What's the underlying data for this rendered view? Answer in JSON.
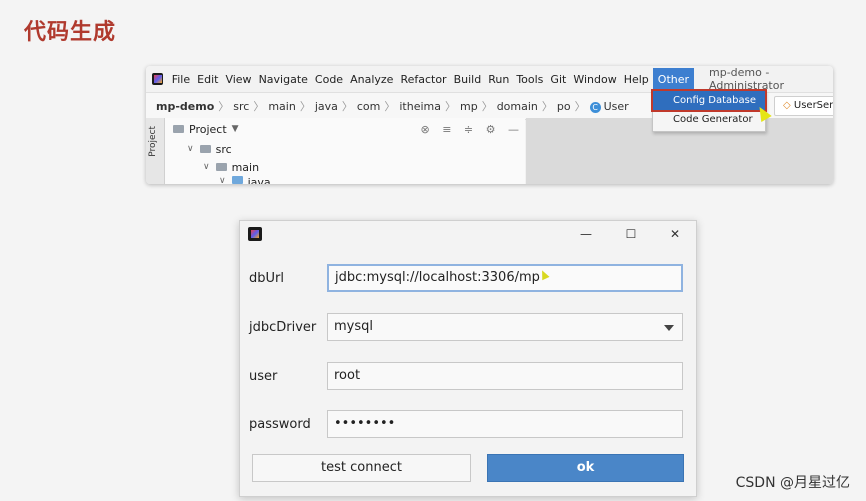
{
  "slide": {
    "title": "代码生成"
  },
  "ide": {
    "menu": [
      "File",
      "Edit",
      "View",
      "Navigate",
      "Code",
      "Analyze",
      "Refactor",
      "Build",
      "Run",
      "Tools",
      "Git",
      "Window",
      "Help",
      "Other"
    ],
    "window_title": "mp-demo - Administrator",
    "breadcrumb": [
      "mp-demo",
      "src",
      "main",
      "java",
      "com",
      "itheima",
      "mp",
      "domain",
      "po",
      "User"
    ],
    "file_tab": "UserSer",
    "side_tab": "Project",
    "project_panel": {
      "title": "Project",
      "tree": [
        "src",
        "main",
        "java"
      ]
    },
    "other_menu": [
      "Config Database",
      "Code Generator"
    ]
  },
  "dialog": {
    "fields": {
      "dbUrl": {
        "label": "dbUrl",
        "value": "jdbc:mysql://localhost:3306/mp"
      },
      "jdbcDriver": {
        "label": "jdbcDriver",
        "value": "mysql"
      },
      "user": {
        "label": "user",
        "value": "root"
      },
      "password": {
        "label": "password",
        "value": "••••••••"
      }
    },
    "buttons": {
      "test": "test connect",
      "ok": "ok"
    },
    "window_controls": {
      "minimize": "—",
      "maximize": "☐",
      "close": "✕"
    }
  },
  "watermark": "CSDN @月星过亿"
}
